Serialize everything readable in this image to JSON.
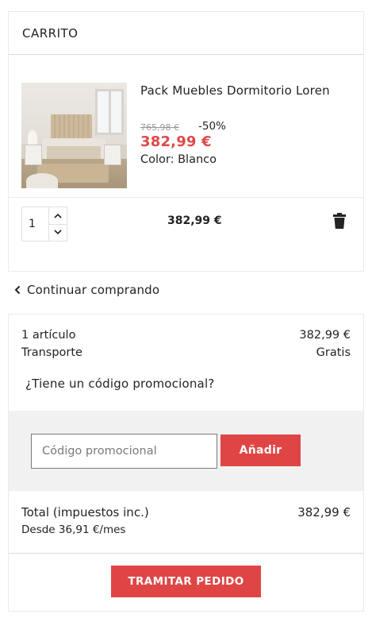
{
  "cart": {
    "title": "CARRITO",
    "product": {
      "name": "Pack Muebles Dormitorio Loren",
      "old_price": "765,98 €",
      "discount": "-50%",
      "price": "382,99 €",
      "color_label": "Color:",
      "color_value": "Blanco",
      "image_icon": "bedroom-product-photo"
    },
    "quantity": "1",
    "line_total": "382,99 €",
    "icons": {
      "increase": "chevron-up-icon",
      "decrease": "chevron-down-icon",
      "delete": "trash-icon"
    }
  },
  "continue_shopping": {
    "label": "Continuar comprando",
    "icon": "chevron-left-icon"
  },
  "summary": {
    "items_label": "1 artículo",
    "items_value": "382,99 €",
    "shipping_label": "Transporte",
    "shipping_value": "Gratis",
    "promo_question": "¿Tiene un código promocional?",
    "promo_placeholder": "Código promocional",
    "promo_button": "Añadir",
    "total_label": "Total (impuestos inc.)",
    "total_value": "382,99 €",
    "installments": "Desde 36,91 €/mes",
    "checkout_button": "TRAMITAR PEDIDO"
  },
  "colors": {
    "accent": "#e04545",
    "price": "#e04848",
    "promo_bg": "#f1f1f1"
  }
}
